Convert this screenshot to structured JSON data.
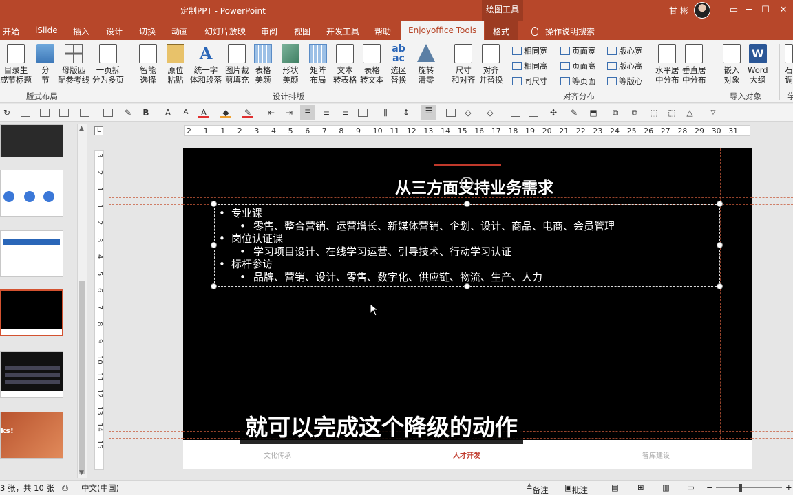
{
  "titlebar": {
    "title": "定制PPT  -  PowerPoint",
    "context_title": "绘图工具",
    "user": "甘 彬",
    "icons": [
      "ribbon-display-icon",
      "minimize-icon",
      "maximize-icon",
      "close-icon"
    ]
  },
  "tabs": [
    "开始",
    "iSlide",
    "插入",
    "设计",
    "切换",
    "动画",
    "幻灯片放映",
    "审阅",
    "视图",
    "开发工具",
    "帮助",
    "Enjoyoffice Tools",
    "格式"
  ],
  "active_tab": "Enjoyoffice Tools",
  "tell_me": "操作说明搜索",
  "ribbon": {
    "group1": {
      "label": "版式布局",
      "buttons": [
        {
          "l1": "目录生",
          "l2": "成节标题"
        },
        {
          "l1": "分",
          "l2": "节"
        },
        {
          "l1": "母版匹",
          "l2": "配参考线"
        },
        {
          "l1": "一页拆",
          "l2": "分为多页"
        }
      ]
    },
    "group2": {
      "label": "设计排版",
      "buttons": [
        {
          "l1": "智能",
          "l2": "选择"
        },
        {
          "l1": "原位",
          "l2": "粘贴"
        },
        {
          "l1": "统一字",
          "l2": "体和段落"
        },
        {
          "l1": "图片裁",
          "l2": "剪填充"
        },
        {
          "l1": "表格",
          "l2": "美颜"
        },
        {
          "l1": "形状",
          "l2": "美颜"
        },
        {
          "l1": "矩阵",
          "l2": "布局"
        },
        {
          "l1": "文本",
          "l2": "转表格"
        },
        {
          "l1": "表格",
          "l2": "转文本"
        },
        {
          "l1": "选区",
          "l2": "替换"
        },
        {
          "l1": "旋转",
          "l2": "清零"
        }
      ]
    },
    "group3": {
      "label": "对齐分布",
      "buttons": [
        {
          "l1": "尺寸",
          "l2": "和对齐"
        },
        {
          "l1": "对齐",
          "l2": "并替换"
        }
      ],
      "small": [
        "相同宽",
        "相同高",
        "同尺寸",
        "页面宽",
        "页面高",
        "等页面",
        "版心宽",
        "版心高",
        "等版心"
      ],
      "buttons2": [
        {
          "l1": "水平居",
          "l2": "中分布"
        },
        {
          "l1": "垂直居",
          "l2": "中分布"
        }
      ]
    },
    "group4": {
      "label": "导入对象",
      "buttons": [
        {
          "l1": "嵌入",
          "l2": "对象"
        },
        {
          "l1": "Word",
          "l2": "大纲"
        }
      ]
    },
    "group5_partial": {
      "l1": "石",
      "l2": "调",
      "label": "学"
    }
  },
  "ruler": {
    "h": [
      "2",
      "1",
      "1",
      "2",
      "3",
      "4",
      "5",
      "6",
      "7",
      "8",
      "9",
      "10",
      "11",
      "12",
      "13",
      "14",
      "15",
      "16",
      "17",
      "18",
      "19",
      "20",
      "21",
      "22",
      "23",
      "24",
      "25",
      "26",
      "27",
      "28",
      "29",
      "30",
      "31"
    ],
    "v": [
      "3",
      "2",
      "1",
      "1",
      "2",
      "3",
      "4",
      "5",
      "6",
      "7",
      "8",
      "9",
      "10",
      "11",
      "12",
      "13",
      "14",
      "15"
    ]
  },
  "thumbnails": {
    "last_thumb_text": "ks!"
  },
  "slide": {
    "title": "从三方面支持业务需求",
    "bullets": [
      {
        "level": 1,
        "text": "专业课"
      },
      {
        "level": 2,
        "text": "零售、整合营销、运营增长、新媒体营销、企划、设计、商品、电商、会员管理"
      },
      {
        "level": 1,
        "text": "岗位认证课"
      },
      {
        "level": 2,
        "text": "学习项目设计、在线学习运营、引导技术、行动学习认证"
      },
      {
        "level": 1,
        "text": "标杆参访"
      },
      {
        "level": 2,
        "text": "品牌、营销、设计、零售、数字化、供应链、物流、生产、人力"
      }
    ],
    "footer": {
      "left": "文化传承",
      "mid": "人才开发",
      "right": "智库建设"
    },
    "accent": "#c0392b"
  },
  "subtitle": "就可以完成这个降级的动作",
  "status": {
    "slide_count": "3 张，共 10 张",
    "language": "中文(中国)",
    "notes": "备注",
    "comments": "批注"
  },
  "colors": {
    "brand": "#b7472a",
    "ribbon_bg": "#f3f3f3"
  }
}
